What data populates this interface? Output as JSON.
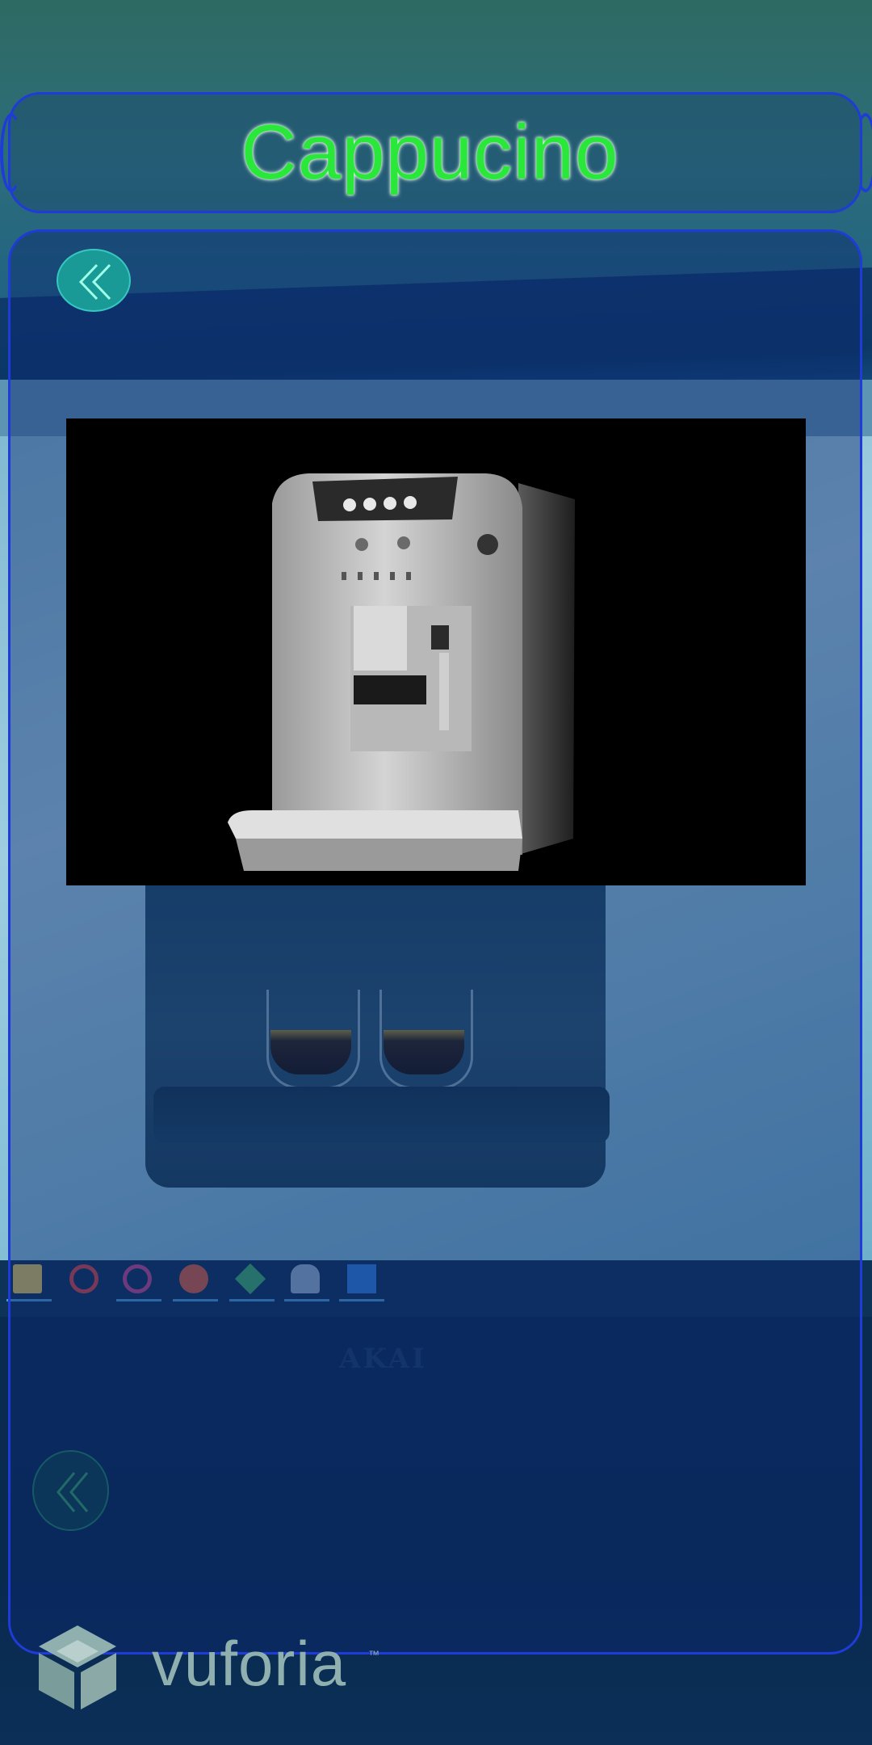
{
  "header": {
    "title": "Cappucino"
  },
  "camera": {
    "brand_label": "AKAI"
  },
  "watermark": {
    "brand": "vuforia",
    "trademark": "™"
  },
  "icons": {
    "back": "chevron-double-left-icon",
    "logo": "vuforia-cube-icon"
  },
  "colors": {
    "title_text": "#29e83a",
    "panel_border": "#1f3bd8",
    "back_button": "#1a9a96"
  }
}
